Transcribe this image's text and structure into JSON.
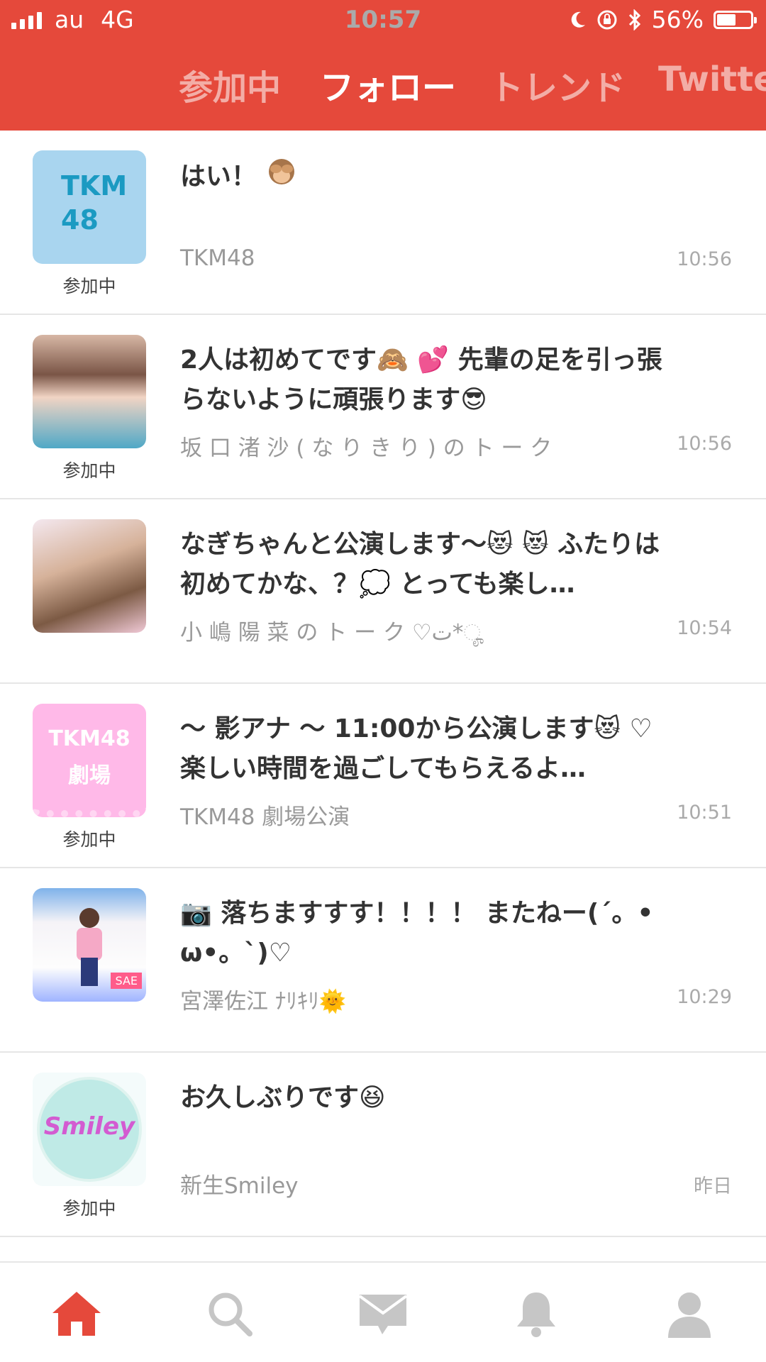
{
  "status_bar": {
    "carrier": "au",
    "network": "4G",
    "time": "10:57",
    "battery": "56%",
    "battery_level": 0.56
  },
  "tabs": [
    {
      "label": "参加中",
      "active": false
    },
    {
      "label": "フォロー",
      "active": true
    },
    {
      "label": "トレンド",
      "active": false
    },
    {
      "label": "Twitte",
      "active": false
    }
  ],
  "feed": [
    {
      "avatar_text_line1": "TKM",
      "avatar_text_line2": "48",
      "badge": "参加中",
      "message": "はい！",
      "emoji": [
        "see-no-evil-monkey"
      ],
      "source": "TKM48",
      "time": "10:56"
    },
    {
      "badge": "参加中",
      "message": "2人は初めてです🙈 💕 先輩の足を引っ張らないように頑張ります😎",
      "source": "坂 口 渚 沙 ( な り き り ) の ト ー ク",
      "time": "10:56"
    },
    {
      "message": "なぎちゃんと公演します〜😻 😻 ふたりは初めてかな、？💭 とっても楽し…",
      "source": "小 嶋 陽 菜 の ト ー ク ♡ت*ೄ",
      "time": "10:54"
    },
    {
      "avatar_text_line1": "TKM48",
      "avatar_text_line2": "劇場",
      "badge": "参加中",
      "message": "〜 影アナ 〜 11:00から公演します😻 ♡ 楽しい時間を過ごしてもらえるよ…",
      "source": "TKM48 劇場公演",
      "time": "10:51"
    },
    {
      "avatar_tag": "SAE",
      "message": "📷 落ちますすす！！！！ またねー(´。• ω•。`)♡",
      "source": "宮澤佐江 ﾅﾘｷﾘ🌞",
      "time": "10:29"
    },
    {
      "avatar_text_line1": "Smiley",
      "badge": "参加中",
      "message": "お久しぶりです😆",
      "source": "新生Smiley",
      "time": "昨日"
    }
  ],
  "bottom_nav": [
    {
      "icon": "home-icon",
      "active": true
    },
    {
      "icon": "search-icon",
      "active": false
    },
    {
      "icon": "mail-icon",
      "active": false
    },
    {
      "icon": "bell-icon",
      "active": false
    },
    {
      "icon": "profile-icon",
      "active": false
    }
  ],
  "colors": {
    "accent": "#e5493b",
    "inactive_icon": "#c6c6c6",
    "divider": "#e6e6e6"
  }
}
